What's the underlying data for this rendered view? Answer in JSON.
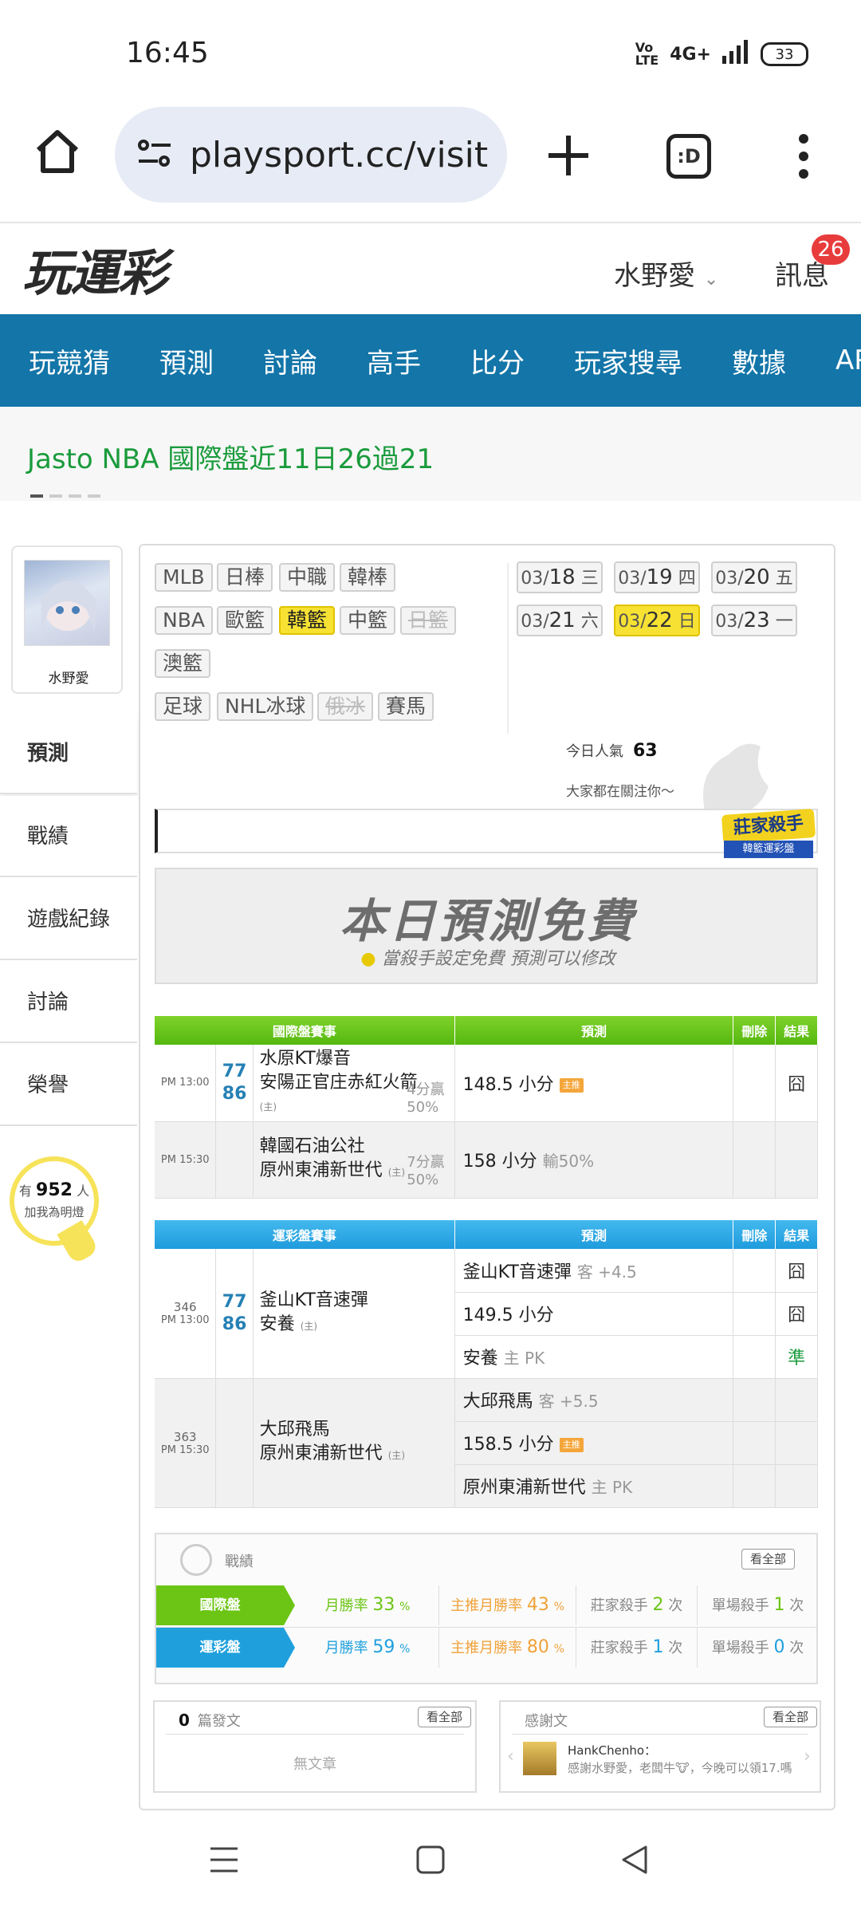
{
  "status": {
    "time": "16:45",
    "network": "4G+",
    "battery": "33"
  },
  "browser": {
    "url": "playsport.cc/visit"
  },
  "header": {
    "logo_text": "玩運彩",
    "username": "水野愛",
    "messages_label": "訊息",
    "messages_count": "26"
  },
  "nav": {
    "items": [
      "玩競猜",
      "預測",
      "討論",
      "高手",
      "比分",
      "玩家搜尋",
      "數據",
      "APP"
    ]
  },
  "ticker": {
    "text": "Jasto NBA 國際盤近11日26過21"
  },
  "sidebar": {
    "profile_name": "水野愛",
    "menu": [
      "預測",
      "戰績",
      "遊戲紀錄",
      "討論",
      "榮譽"
    ],
    "followers_prefix": "有",
    "followers_count": "952",
    "followers_suffix": "人",
    "followers_cta": "加我為明燈"
  },
  "filters": {
    "row1": [
      "MLB",
      "日棒",
      "中職",
      "韓棒"
    ],
    "row2": [
      "NBA",
      "歐籃",
      "韓籃",
      "中籃",
      "日籃"
    ],
    "row3": [
      "澳籃"
    ],
    "row4": [
      "足球",
      "NHL冰球",
      "俄冰",
      "賽馬"
    ],
    "selected": "韓籃",
    "disabled": [
      "日籃",
      "俄冰"
    ]
  },
  "dates": [
    {
      "md": "03/",
      "d": "18",
      "w": "三"
    },
    {
      "md": "03/",
      "d": "19",
      "w": "四"
    },
    {
      "md": "03/",
      "d": "20",
      "w": "五"
    },
    {
      "md": "03/",
      "d": "21",
      "w": "六"
    },
    {
      "md": "03/",
      "d": "22",
      "w": "日"
    },
    {
      "md": "03/",
      "d": "23",
      "w": "一"
    }
  ],
  "popularity": {
    "label": "今日人氣",
    "count": "63",
    "attention": "大家都在關注你～"
  },
  "killer_badge": {
    "title": "莊家殺手",
    "sub": "韓籃運彩盤"
  },
  "free_banner": {
    "title": "本日預測免費",
    "subtitle": "當殺手設定免費  預測可以修改"
  },
  "intl_table": {
    "headers": [
      "國際盤賽事",
      "預測",
      "刪除",
      "結果"
    ],
    "rows": [
      {
        "time": "PM 13:00",
        "num_away": "77",
        "num_home": "86",
        "away": "水原KT爆音",
        "home": "安陽正官庄赤紅火箭",
        "home_mark": "(主)",
        "margin": "4分贏",
        "pct": "50%",
        "prediction": "148.5 小分",
        "pred_tag": "主推",
        "result": "囧"
      },
      {
        "time": "PM 15:30",
        "away": "韓國石油公社",
        "home": "原州東浦新世代",
        "home_mark": "(主)",
        "margin": "7分贏",
        "pct": "50%",
        "prediction": "158 小分",
        "pred_hint": "輸50%",
        "result": ""
      }
    ]
  },
  "lottery_table": {
    "headers": [
      "運彩盤賽事",
      "預測",
      "刪除",
      "結果"
    ],
    "games": [
      {
        "id": "346",
        "time": "PM 13:00",
        "num_away": "77",
        "num_home": "86",
        "away": "釜山KT音速彈",
        "home": "安養",
        "home_mark": "(主)",
        "preds": [
          {
            "text": "釜山KT音速彈",
            "hint": "客 +4.5",
            "result": "囧"
          },
          {
            "text": "149.5 小分",
            "hint": "",
            "result": "囧"
          },
          {
            "text": "安養",
            "hint": "主 PK",
            "result": "準"
          }
        ]
      },
      {
        "id": "363",
        "time": "PM 15:30",
        "away": "大邱飛馬",
        "home": "原州東浦新世代",
        "home_mark": "(主)",
        "preds": [
          {
            "text": "大邱飛馬",
            "hint": "客 +5.5",
            "result": ""
          },
          {
            "text": "158.5 小分",
            "tag": "主推",
            "result": ""
          },
          {
            "text": "原州東浦新世代",
            "hint": "主 PK",
            "result": ""
          }
        ]
      }
    ]
  },
  "record": {
    "label": "戰績",
    "view_all": "看全部",
    "rows": [
      {
        "name": "國際盤",
        "month_label": "月勝率",
        "month_val": "33",
        "main_label": "主推月勝率",
        "main_val": "43",
        "killer_label": "莊家殺手",
        "killer_val": "2",
        "single_label": "單場殺手",
        "single_val": "1",
        "unit": "次",
        "pct": "%"
      },
      {
        "name": "運彩盤",
        "month_label": "月勝率",
        "month_val": "59",
        "main_label": "主推月勝率",
        "main_val": "80",
        "killer_label": "莊家殺手",
        "killer_val": "1",
        "single_label": "單場殺手",
        "single_val": "0",
        "unit": "次",
        "pct": "%"
      }
    ],
    "colors": {
      "intl": "#6cc514",
      "lottery": "#1fa0dd"
    }
  },
  "posts": {
    "count": "0",
    "label": "篇發文",
    "view_all": "看全部",
    "empty": "無文章"
  },
  "thanks": {
    "label": "感謝文",
    "view_all": "看全部",
    "user": "HankChenho：",
    "message": "感謝水野愛，老闆牛🐮，今晚可以領17.嗎"
  }
}
